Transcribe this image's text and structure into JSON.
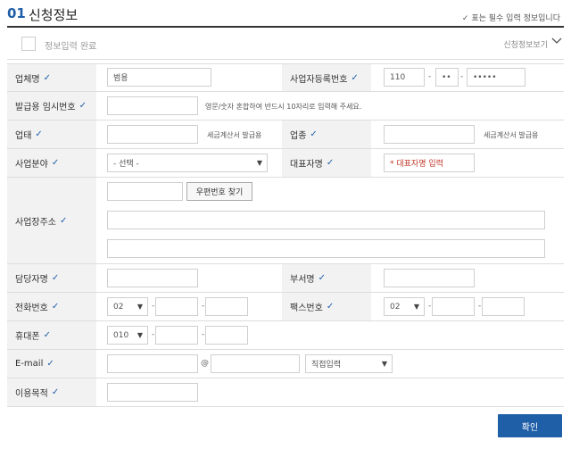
{
  "header": {
    "num": "01",
    "title": "신청정보",
    "required_note": "✓ 표는 필수 입력 정보입니다"
  },
  "subbar": {
    "complete_label": "정보입력 완료",
    "toggle_label": "신청정보보기"
  },
  "form": {
    "company_name": {
      "label": "업체명",
      "value": "범용"
    },
    "business_reg": {
      "label": "사업자등록번호",
      "part1": "110",
      "part2": "••",
      "part3": "•••••"
    },
    "temp_number": {
      "label": "발급용 임시번호",
      "hint": "영문/숫자 혼합하여 반드시 10자리로 입력해 주세요."
    },
    "business_type": {
      "label": "업태",
      "hint": "세금계산서 발급용"
    },
    "business_item": {
      "label": "업종",
      "hint": "세금계산서 발급용"
    },
    "business_field": {
      "label": "사업분야",
      "selected": "- 선택 -"
    },
    "ceo_name": {
      "label": "대표자명",
      "placeholder": "* 대표자명 입력"
    },
    "address": {
      "label": "사업장주소",
      "zip_button": "우편번호 찾기"
    },
    "manager_name": {
      "label": "담당자명"
    },
    "department": {
      "label": "부서명"
    },
    "phone": {
      "label": "전화번호",
      "area": "02"
    },
    "fax": {
      "label": "팩스번호",
      "area": "02"
    },
    "mobile": {
      "label": "휴대폰",
      "prefix": "010"
    },
    "email": {
      "label": "E-mail",
      "at": "@",
      "domain_select": "직접입력"
    },
    "purpose": {
      "label": "이용목적"
    }
  },
  "confirm_button": "확인",
  "check_mark": "✓",
  "dash": "-",
  "arrow": "▼"
}
